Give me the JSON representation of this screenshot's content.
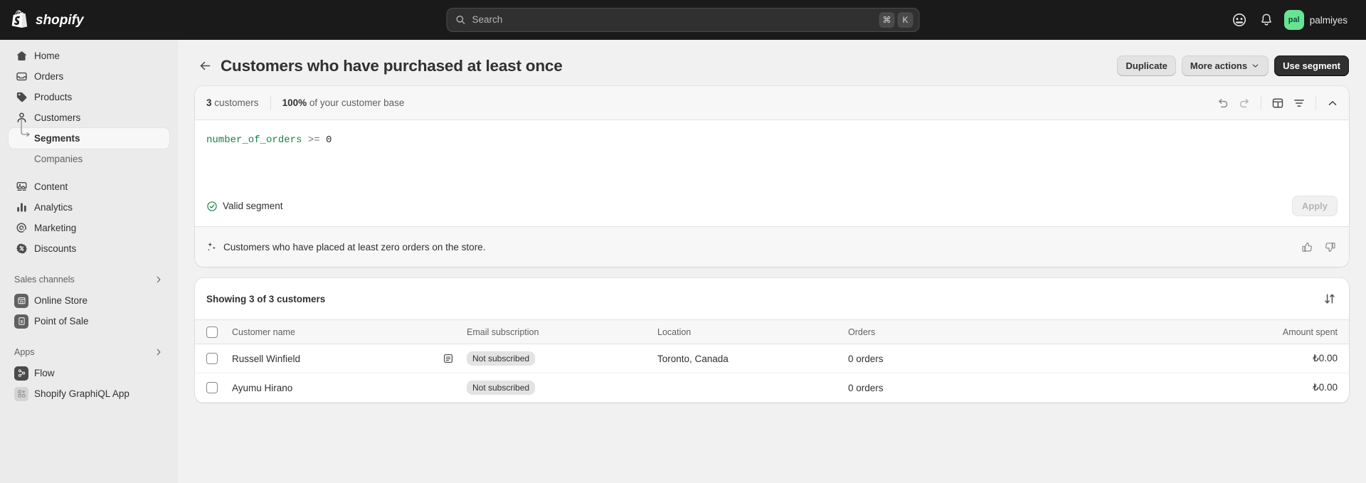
{
  "topbar": {
    "brand": "shopify",
    "search": {
      "placeholder": "Search",
      "key_cmd": "⌘",
      "key_letter": "K"
    },
    "user": {
      "initials": "pal",
      "name": "palmiyes"
    }
  },
  "sidebar": {
    "items": [
      {
        "label": "Home",
        "icon": "home-icon"
      },
      {
        "label": "Orders",
        "icon": "orders-icon"
      },
      {
        "label": "Products",
        "icon": "products-tag-icon"
      },
      {
        "label": "Customers",
        "icon": "customer-person-icon"
      }
    ],
    "customer_children": [
      {
        "label": "Segments",
        "selected": true
      },
      {
        "label": "Companies",
        "selected": false
      }
    ],
    "items2": [
      {
        "label": "Content",
        "icon": "content-icon"
      },
      {
        "label": "Analytics",
        "icon": "analytics-bars-icon"
      },
      {
        "label": "Marketing",
        "icon": "marketing-target-icon"
      },
      {
        "label": "Discounts",
        "icon": "discount-percent-icon"
      }
    ],
    "sales_channels_label": "Sales channels",
    "sales_channels": [
      {
        "label": "Online Store",
        "icon": "storefront-icon"
      },
      {
        "label": "Point of Sale",
        "icon": "pos-icon"
      }
    ],
    "apps_label": "Apps",
    "apps": [
      {
        "label": "Flow",
        "icon": "flow-icon"
      },
      {
        "label": "Shopify GraphiQL App",
        "icon": "graphiql-icon"
      }
    ]
  },
  "page": {
    "title": "Customers who have purchased at least once",
    "back_label": "Back",
    "actions": {
      "duplicate": "Duplicate",
      "more_actions": "More actions",
      "use_segment": "Use segment"
    }
  },
  "query_card": {
    "customers_count": "3",
    "customers_label": "customers",
    "percent": "100%",
    "percent_label": "of your customer base",
    "tools": [
      {
        "name": "undo-icon",
        "title": "Undo"
      },
      {
        "name": "redo-icon",
        "title": "Redo"
      },
      {
        "name": "save-view-icon",
        "title": "Save view"
      },
      {
        "name": "filter-icon",
        "title": "Filter"
      },
      {
        "name": "chevron-up-icon",
        "title": "Collapse"
      }
    ],
    "query": {
      "field": "number_of_orders",
      "operator": ">=",
      "value": "0"
    },
    "validity_text": "Valid segment",
    "apply_label": "Apply",
    "suggestion_text": "Customers who have placed at least zero orders on the store."
  },
  "table_card": {
    "showing_text": "Showing 3 of 3 customers",
    "columns": [
      "Customer name",
      "Email subscription",
      "Location",
      "Orders",
      "Amount spent"
    ],
    "rows": [
      {
        "name": "Russell Winfield",
        "has_note": true,
        "email_subscription": "Not subscribed",
        "location": "Toronto, Canada",
        "orders": "0 orders",
        "amount": "₺0.00"
      },
      {
        "name": "Ayumu Hirano",
        "has_note": false,
        "email_subscription": "Not subscribed",
        "location": "",
        "orders": "0 orders",
        "amount": "₺0.00"
      }
    ]
  },
  "colors": {
    "topbar_bg": "#1a1a1a",
    "sidebar_bg": "#ebebeb",
    "main_bg": "#f1f1f1",
    "accent_green": "#68e394",
    "valid_green": "#1a7f4b",
    "primary_btn": "#303030"
  }
}
